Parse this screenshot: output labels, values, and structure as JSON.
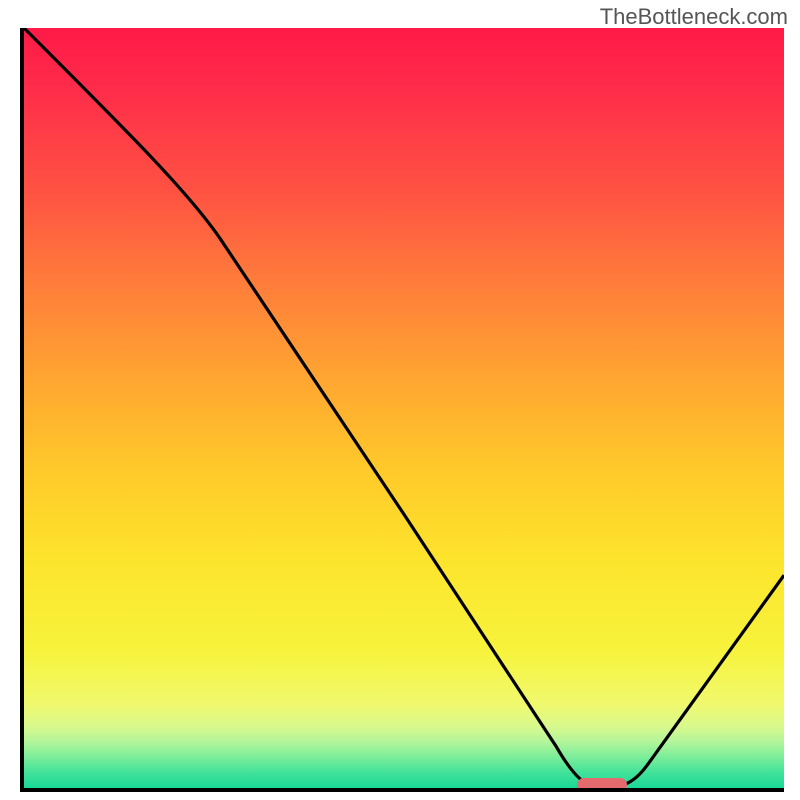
{
  "watermark": "TheBottleneck.com",
  "chart_data": {
    "type": "line",
    "title": "",
    "xlabel": "",
    "ylabel": "",
    "x": [
      0,
      26,
      50,
      74,
      78,
      100
    ],
    "values": [
      100,
      72,
      36,
      0,
      0,
      28
    ],
    "xlim": [
      0,
      100
    ],
    "ylim": [
      0,
      100
    ],
    "background_gradient": {
      "top_color": "#ff1a47",
      "bottom_color": "#1ad897"
    },
    "marker": {
      "x": 76,
      "y": 0,
      "color": "#e56a6d"
    },
    "curve_color": "#000000"
  }
}
